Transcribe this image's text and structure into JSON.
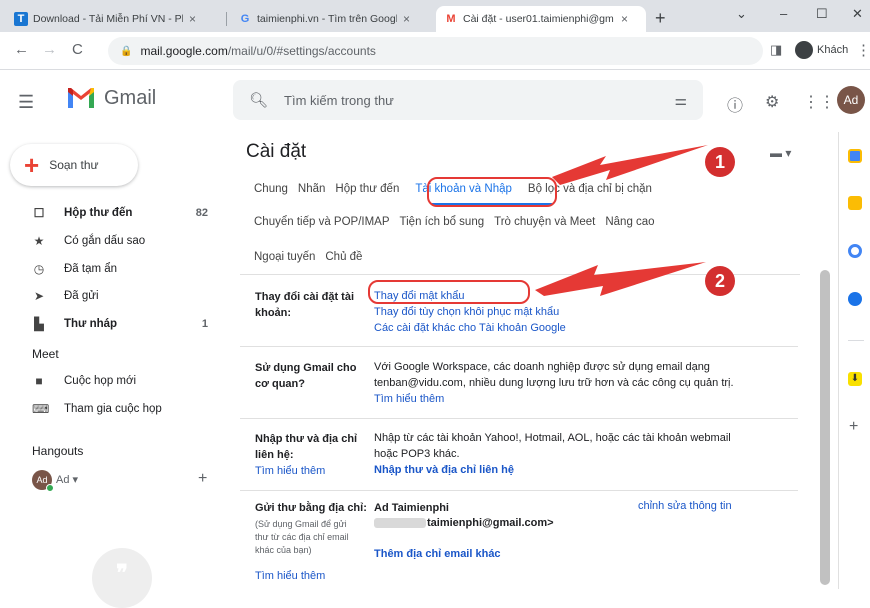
{
  "browser": {
    "tabs": [
      {
        "icon": "T",
        "title": "Download - Tải Miễn Phí VN - Ph",
        "close": "×"
      },
      {
        "icon": "G",
        "title": "taimienphi.vn - Tìm trên Google",
        "close": "×"
      },
      {
        "icon": "M",
        "title": "Cài đặt - user01.taimienphi@gm",
        "close": "×"
      }
    ],
    "new_tab": "+",
    "url_host": "mail.google.com",
    "url_path": "/mail/u/0/#settings/accounts",
    "guest_label": "Khách"
  },
  "gmail": {
    "logo_text": "Gmail",
    "search_placeholder": "Tìm kiếm trong thư",
    "avatar": "Ad",
    "compose_label": "Soạn thư",
    "sidebar": [
      {
        "label": "Hộp thư đến",
        "count": "82",
        "icon": "inbox-icon"
      },
      {
        "label": "Có gắn dấu sao",
        "count": "",
        "icon": "star-icon"
      },
      {
        "label": "Đã tạm ẩn",
        "count": "",
        "icon": "clock-icon"
      },
      {
        "label": "Đã gửi",
        "count": "",
        "icon": "send-icon"
      },
      {
        "label": "Thư nháp",
        "count": "1",
        "icon": "draft-icon"
      }
    ],
    "meet_heading": "Meet",
    "meet_items": [
      "Cuộc họp mới",
      "Tham gia cuộc họp"
    ],
    "hangouts_heading": "Hangouts",
    "hangouts_user": "Ad",
    "hangouts_avatar": "Ad",
    "hangouts_add": "+"
  },
  "settings": {
    "title": "Cài đặt",
    "tabs_row1": [
      "Chung",
      "Nhãn",
      "Hộp thư đến",
      "Tài khoản và Nhập",
      "Bộ lọc và địa chỉ bị chặn"
    ],
    "tabs_row2": [
      "Chuyển tiếp và POP/IMAP",
      "Tiện ích bổ sung",
      "Trò chuyện và Meet",
      "Nâng cao"
    ],
    "tabs_row3": [
      "Ngoại tuyến",
      "Chủ đề"
    ],
    "active_tab": "Tài khoản và Nhập",
    "sections": {
      "change_account": {
        "label_line1": "Thay đổi cài đặt tài",
        "label_line2": "khoản:",
        "link1": "Thay đổi mật khẩu",
        "link2": "Thay đổi tùy chọn khôi phục mật khẩu",
        "link3": "Các cài đặt khác cho Tài khoản Google"
      },
      "workspace": {
        "label_line1": "Sử dụng Gmail cho",
        "label_line2": "cơ quan?",
        "text_line1": "Với Google Workspace, các doanh nghiệp được sử dụng email dạng",
        "text_line2": "tenban@vidu.com, nhiều dung lượng lưu trữ hơn và các công cụ quản trị.",
        "link": "Tìm hiểu thêm"
      },
      "import": {
        "label_line1": "Nhập thư và địa chỉ",
        "label_line2": "liên hệ:",
        "label_link": "Tìm hiểu thêm",
        "text_line1": "Nhập từ các tài khoản Yahoo!, Hotmail, AOL, hoặc các tài khoản webmail",
        "text_line2": "hoặc POP3 khác.",
        "action": "Nhập thư và địa chỉ liên hệ"
      },
      "send_as": {
        "label": "Gửi thư bằng địa chỉ:",
        "note_line1": "(Sử dụng Gmail để gửi",
        "note_line2": "thư từ các địa chỉ email",
        "note_line3": "khác của bạn)",
        "label_link": "Tìm hiểu thêm",
        "name": "Ad Taimienphi",
        "email": "taimienphi@gmail.com>",
        "edit_link": "chỉnh sửa thông tin",
        "add_link": "Thêm địa chỉ email khác"
      }
    }
  },
  "annotations": {
    "badge1": "1",
    "badge2": "2",
    "color": "#e53935"
  }
}
